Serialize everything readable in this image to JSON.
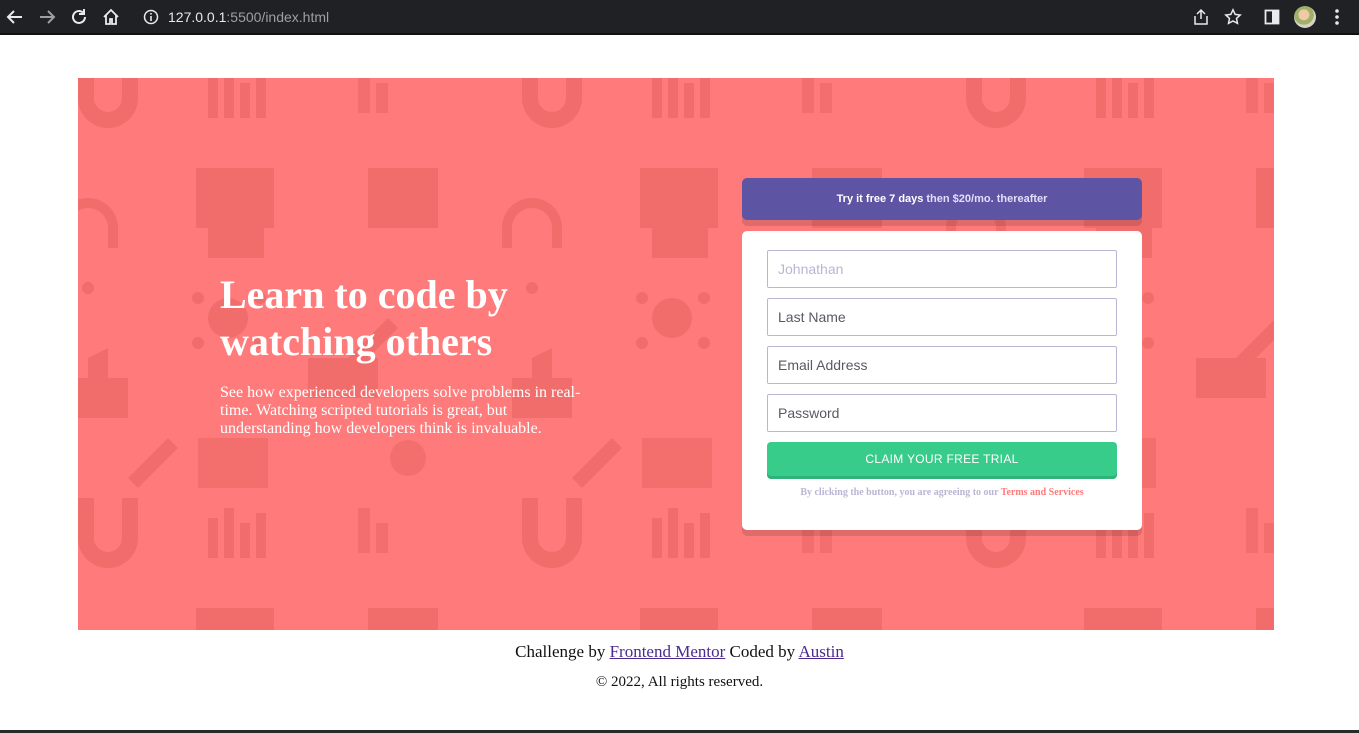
{
  "browser": {
    "url_host": "127.0.0.1",
    "url_rest": ":5500/index.html",
    "icons": [
      "back-arrow-icon",
      "forward-arrow-icon",
      "reload-icon",
      "home-icon",
      "info-icon",
      "share-icon",
      "star-icon",
      "side-panel-icon",
      "avatar",
      "menu-dots-icon"
    ]
  },
  "hero": {
    "headline": "Learn to code by watching others",
    "description": "See how experienced developers solve problems in real-time. Watching scripted tutorials is great, but understanding how developers think is invaluable.",
    "background_color": "#ff7a7a"
  },
  "trial": {
    "bold": "Try it free 7 days",
    "rest": "then $20/mo. thereafter",
    "color": "#5e54a4"
  },
  "form": {
    "first_name_placeholder": "Johnathan",
    "last_name_placeholder": "Last Name",
    "email_placeholder": "Email Address",
    "password_placeholder": "Password",
    "submit_label": "CLAIM YOUR FREE TRIAL",
    "submit_color": "#38cc8b",
    "terms_prefix": "By clicking the button, you are agreeing to our ",
    "terms_link": "Terms and Services"
  },
  "footer": {
    "challenge_prefix": "Challenge by ",
    "challenge_link": "Frontend Mentor",
    "coded_prefix": " Coded by ",
    "coded_link": "Austin",
    "copyright": "© 2022, All rights reserved."
  }
}
